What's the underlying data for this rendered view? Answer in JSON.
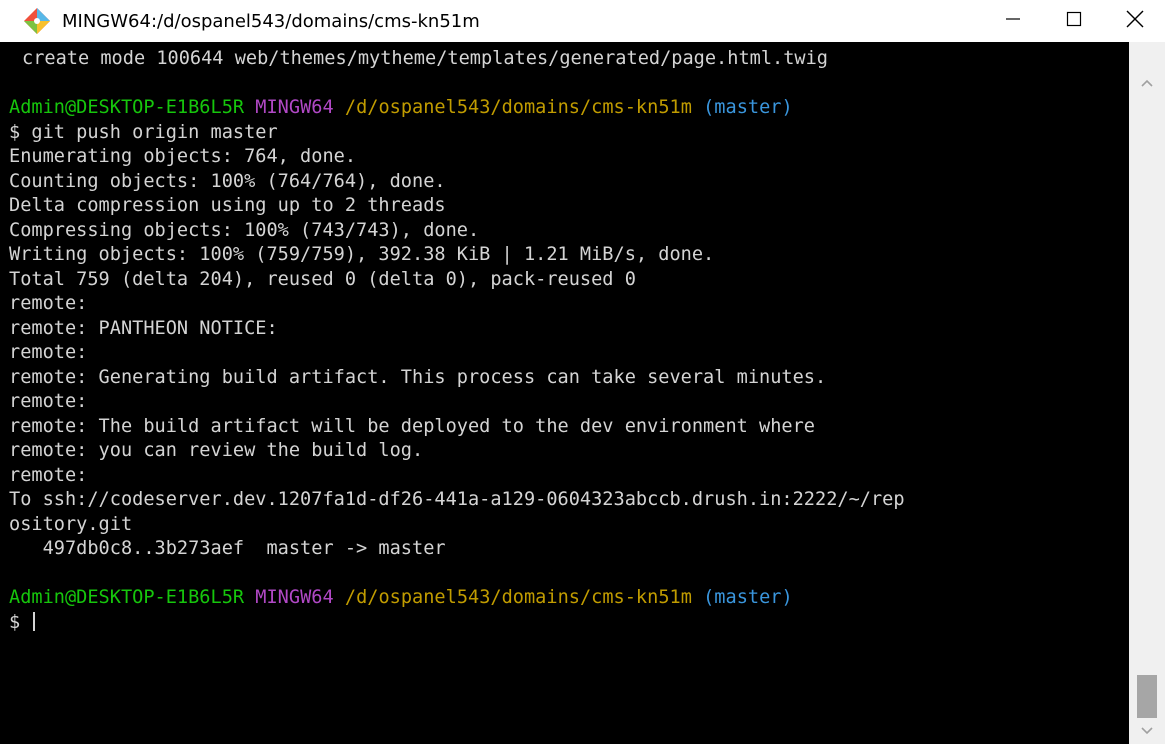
{
  "window": {
    "title": "MINGW64:/d/ospanel543/domains/cms-kn51m",
    "icons": {
      "app": "git-bash-icon",
      "minimize": "minimize-icon",
      "maximize": "maximize-icon",
      "close": "close-icon"
    }
  },
  "terminal": {
    "line0": "create mode 100644 web/themes/mytheme/templates/generated/page.html.twig",
    "prompt1": {
      "user": "Admin@DESKTOP-E1B6L5R",
      "host": "MINGW64",
      "path": "/d/ospanel543/domains/cms-kn51m",
      "branch": "(master)"
    },
    "command": "$ git push origin master",
    "output": [
      "Enumerating objects: 764, done.",
      "Counting objects: 100% (764/764), done.",
      "Delta compression using up to 2 threads",
      "Compressing objects: 100% (743/743), done.",
      "Writing objects: 100% (759/759), 392.38 KiB | 1.21 MiB/s, done.",
      "Total 759 (delta 204), reused 0 (delta 0), pack-reused 0",
      "remote:",
      "remote: PANTHEON NOTICE:",
      "remote:",
      "remote: Generating build artifact. This process can take several minutes.",
      "remote:",
      "remote: The build artifact will be deployed to the dev environment where",
      "remote: you can review the build log.",
      "remote:",
      "To ssh://codeserver.dev.1207fa1d-df26-441a-a129-0604323abccb.drush.in:2222/~/rep",
      "ository.git",
      "   497db0c8..3b273aef  master -> master"
    ],
    "prompt2": {
      "user": "Admin@DESKTOP-E1B6L5R",
      "host": "MINGW64",
      "path": "/d/ospanel543/domains/cms-kn51m",
      "branch": "(master)"
    },
    "input_prompt": "$ "
  },
  "scrollbar": {
    "up_icon": "chevron-up-icon",
    "down_icon": "chevron-down-icon"
  }
}
